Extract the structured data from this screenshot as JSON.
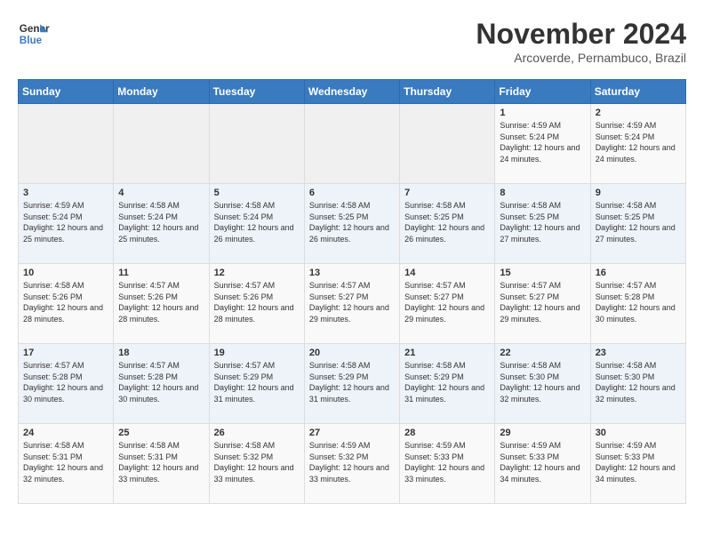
{
  "header": {
    "logo_line1": "General",
    "logo_line2": "Blue",
    "month": "November 2024",
    "location": "Arcoverde, Pernambuco, Brazil"
  },
  "weekdays": [
    "Sunday",
    "Monday",
    "Tuesday",
    "Wednesday",
    "Thursday",
    "Friday",
    "Saturday"
  ],
  "weeks": [
    [
      {
        "day": "",
        "info": ""
      },
      {
        "day": "",
        "info": ""
      },
      {
        "day": "",
        "info": ""
      },
      {
        "day": "",
        "info": ""
      },
      {
        "day": "",
        "info": ""
      },
      {
        "day": "1",
        "info": "Sunrise: 4:59 AM\nSunset: 5:24 PM\nDaylight: 12 hours and 24 minutes."
      },
      {
        "day": "2",
        "info": "Sunrise: 4:59 AM\nSunset: 5:24 PM\nDaylight: 12 hours and 24 minutes."
      }
    ],
    [
      {
        "day": "3",
        "info": "Sunrise: 4:59 AM\nSunset: 5:24 PM\nDaylight: 12 hours and 25 minutes."
      },
      {
        "day": "4",
        "info": "Sunrise: 4:58 AM\nSunset: 5:24 PM\nDaylight: 12 hours and 25 minutes."
      },
      {
        "day": "5",
        "info": "Sunrise: 4:58 AM\nSunset: 5:24 PM\nDaylight: 12 hours and 26 minutes."
      },
      {
        "day": "6",
        "info": "Sunrise: 4:58 AM\nSunset: 5:25 PM\nDaylight: 12 hours and 26 minutes."
      },
      {
        "day": "7",
        "info": "Sunrise: 4:58 AM\nSunset: 5:25 PM\nDaylight: 12 hours and 26 minutes."
      },
      {
        "day": "8",
        "info": "Sunrise: 4:58 AM\nSunset: 5:25 PM\nDaylight: 12 hours and 27 minutes."
      },
      {
        "day": "9",
        "info": "Sunrise: 4:58 AM\nSunset: 5:25 PM\nDaylight: 12 hours and 27 minutes."
      }
    ],
    [
      {
        "day": "10",
        "info": "Sunrise: 4:58 AM\nSunset: 5:26 PM\nDaylight: 12 hours and 28 minutes."
      },
      {
        "day": "11",
        "info": "Sunrise: 4:57 AM\nSunset: 5:26 PM\nDaylight: 12 hours and 28 minutes."
      },
      {
        "day": "12",
        "info": "Sunrise: 4:57 AM\nSunset: 5:26 PM\nDaylight: 12 hours and 28 minutes."
      },
      {
        "day": "13",
        "info": "Sunrise: 4:57 AM\nSunset: 5:27 PM\nDaylight: 12 hours and 29 minutes."
      },
      {
        "day": "14",
        "info": "Sunrise: 4:57 AM\nSunset: 5:27 PM\nDaylight: 12 hours and 29 minutes."
      },
      {
        "day": "15",
        "info": "Sunrise: 4:57 AM\nSunset: 5:27 PM\nDaylight: 12 hours and 29 minutes."
      },
      {
        "day": "16",
        "info": "Sunrise: 4:57 AM\nSunset: 5:28 PM\nDaylight: 12 hours and 30 minutes."
      }
    ],
    [
      {
        "day": "17",
        "info": "Sunrise: 4:57 AM\nSunset: 5:28 PM\nDaylight: 12 hours and 30 minutes."
      },
      {
        "day": "18",
        "info": "Sunrise: 4:57 AM\nSunset: 5:28 PM\nDaylight: 12 hours and 30 minutes."
      },
      {
        "day": "19",
        "info": "Sunrise: 4:57 AM\nSunset: 5:29 PM\nDaylight: 12 hours and 31 minutes."
      },
      {
        "day": "20",
        "info": "Sunrise: 4:58 AM\nSunset: 5:29 PM\nDaylight: 12 hours and 31 minutes."
      },
      {
        "day": "21",
        "info": "Sunrise: 4:58 AM\nSunset: 5:29 PM\nDaylight: 12 hours and 31 minutes."
      },
      {
        "day": "22",
        "info": "Sunrise: 4:58 AM\nSunset: 5:30 PM\nDaylight: 12 hours and 32 minutes."
      },
      {
        "day": "23",
        "info": "Sunrise: 4:58 AM\nSunset: 5:30 PM\nDaylight: 12 hours and 32 minutes."
      }
    ],
    [
      {
        "day": "24",
        "info": "Sunrise: 4:58 AM\nSunset: 5:31 PM\nDaylight: 12 hours and 32 minutes."
      },
      {
        "day": "25",
        "info": "Sunrise: 4:58 AM\nSunset: 5:31 PM\nDaylight: 12 hours and 33 minutes."
      },
      {
        "day": "26",
        "info": "Sunrise: 4:58 AM\nSunset: 5:32 PM\nDaylight: 12 hours and 33 minutes."
      },
      {
        "day": "27",
        "info": "Sunrise: 4:59 AM\nSunset: 5:32 PM\nDaylight: 12 hours and 33 minutes."
      },
      {
        "day": "28",
        "info": "Sunrise: 4:59 AM\nSunset: 5:33 PM\nDaylight: 12 hours and 33 minutes."
      },
      {
        "day": "29",
        "info": "Sunrise: 4:59 AM\nSunset: 5:33 PM\nDaylight: 12 hours and 34 minutes."
      },
      {
        "day": "30",
        "info": "Sunrise: 4:59 AM\nSunset: 5:33 PM\nDaylight: 12 hours and 34 minutes."
      }
    ]
  ]
}
